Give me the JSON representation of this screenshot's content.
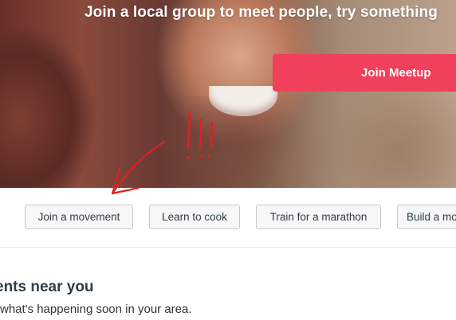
{
  "hero": {
    "tagline": "Join a local group to meet people, try something",
    "cta_label": "Join Meetup"
  },
  "chips": [
    {
      "label": "Join a movement"
    },
    {
      "label": "Learn to cook"
    },
    {
      "label": "Train for a marathon"
    },
    {
      "label": "Build a mo"
    }
  ],
  "events_section": {
    "title": "ents near you",
    "subtitle": "what's happening soon in your area."
  },
  "colors": {
    "accent": "#f0405c",
    "annotation": "#e02020"
  }
}
